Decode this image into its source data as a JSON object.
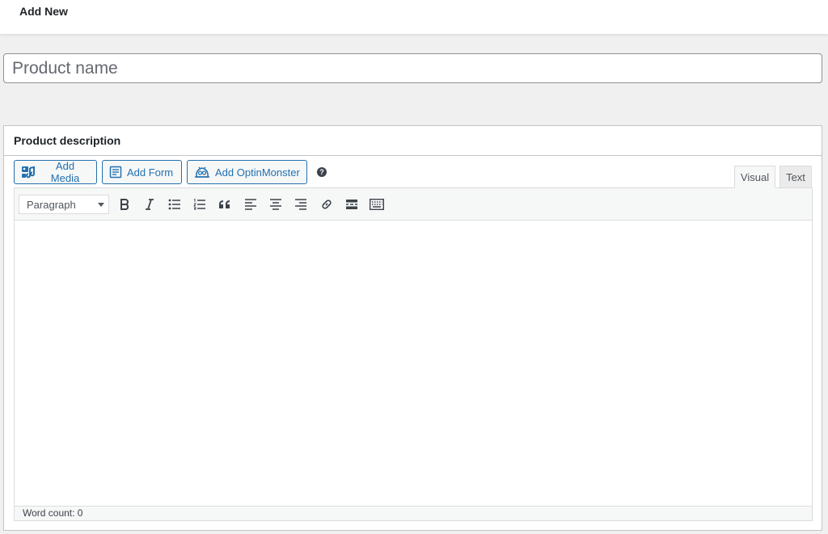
{
  "header": {
    "title": "Add New"
  },
  "title_field": {
    "placeholder": "Product name",
    "value": ""
  },
  "description_box": {
    "title": "Product description",
    "buttons": {
      "add_media": "Add Media",
      "add_form": "Add Form",
      "add_optinmonster": "Add OptinMonster"
    },
    "help_glyph": "?",
    "tabs": {
      "visual": "Visual",
      "text": "Text"
    },
    "toolbar": {
      "format_select": "Paragraph",
      "tools": [
        "bold",
        "italic",
        "bulleted-list",
        "numbered-list",
        "blockquote",
        "align-left",
        "align-center",
        "align-right",
        "insert-link",
        "read-more",
        "toolbar-toggle"
      ]
    },
    "status": {
      "word_count": "Word count: 0"
    }
  },
  "colors": {
    "accent": "#2271b1",
    "background": "#f0f0f1",
    "border": "#c3c4c7"
  },
  "icons": [
    "media-icon",
    "form-icon",
    "optinmonster-icon",
    "help-icon"
  ]
}
